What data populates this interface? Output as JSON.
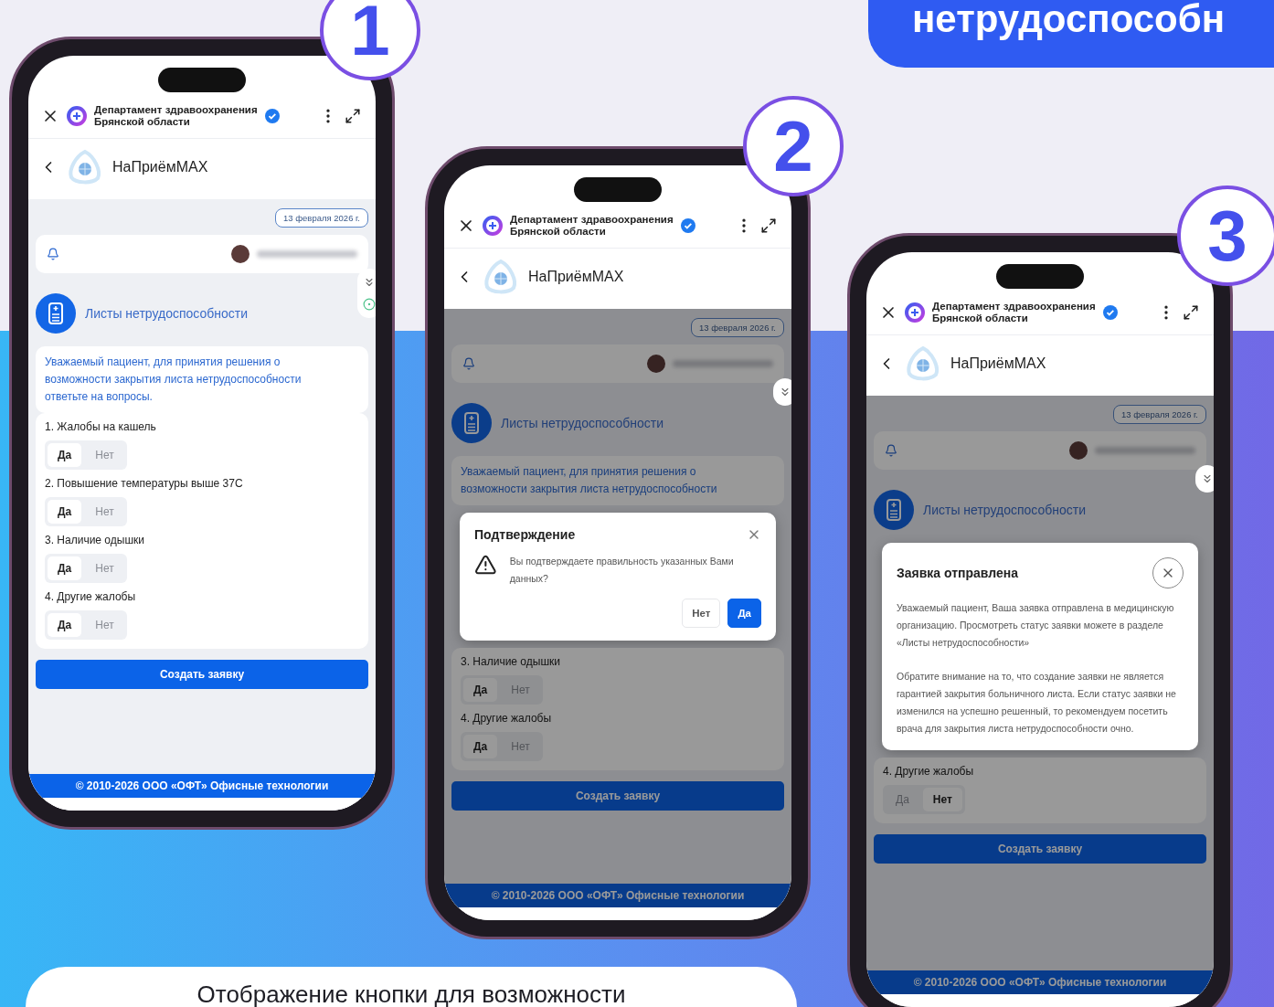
{
  "banner": {
    "text": "нетрудоспособн"
  },
  "caption": {
    "text": "Отображение кнопки для возможности"
  },
  "phones": [
    {
      "step": "1",
      "dimmed": false,
      "org_title_lines": [
        "Департамент здравоохранения",
        "Брянской области"
      ],
      "bot_name": "НаПриёмMAX",
      "date": "13 февраля 2026 г.",
      "side_tools": [
        {
          "kind": "chevron"
        },
        {
          "kind": "target"
        }
      ],
      "section_title": "Листы нетрудоспособности",
      "intro": "Уважаемый пациент, для принятия решения о возможности закрытия листа нетрудоспособности ответьте на вопросы.",
      "questions": [
        {
          "text": "1. Жалобы на кашель",
          "answers": [
            {
              "label": "Да",
              "selected": true
            },
            {
              "label": "Нет",
              "selected": false
            }
          ]
        },
        {
          "text": "2. Повышение температуры выше 37С",
          "answers": [
            {
              "label": "Да",
              "selected": true
            },
            {
              "label": "Нет",
              "selected": false
            }
          ]
        },
        {
          "text": "3. Наличие одышки",
          "answers": [
            {
              "label": "Да",
              "selected": true
            },
            {
              "label": "Нет",
              "selected": false
            }
          ]
        },
        {
          "text": "4. Другие жалобы",
          "answers": [
            {
              "label": "Да",
              "selected": true
            },
            {
              "label": "Нет",
              "selected": false
            }
          ]
        }
      ],
      "create_button": "Создать заявку",
      "footer": "© 2010-2026 ООО «ОФТ» Офисные технологии"
    },
    {
      "step": "2",
      "dimmed": true,
      "org_title_lines": [
        "Департамент здравоохранения",
        "Брянской области"
      ],
      "bot_name": "НаПриёмMAX",
      "date": "13 февраля 2026 г.",
      "side_tools": [
        {
          "kind": "chevron"
        }
      ],
      "section_title": "Листы нетрудоспособности",
      "intro": "Уважаемый пациент, для принятия решения о возможности закрытия листа нетрудоспособности",
      "modal": {
        "kind": "confirm",
        "title": "Подтверждение",
        "paragraphs": [
          "Вы подтверждаете правильность указанных Вами данных?"
        ],
        "buttons": [
          {
            "label": "Нет",
            "kind": "secondary"
          },
          {
            "label": "Да",
            "kind": "primary"
          }
        ]
      },
      "questions": [
        {
          "text": "3. Наличие одышки",
          "answers": [
            {
              "label": "Да",
              "selected": true
            },
            {
              "label": "Нет",
              "selected": false
            }
          ]
        },
        {
          "text": "4. Другие жалобы",
          "answers": [
            {
              "label": "Да",
              "selected": true
            },
            {
              "label": "Нет",
              "selected": false
            }
          ]
        }
      ],
      "create_button": "Создать заявку",
      "footer": "© 2010-2026 ООО «ОФТ» Офисные технологии"
    },
    {
      "step": "3",
      "dimmed": true,
      "org_title_lines": [
        "Департамент здравоохранения",
        "Брянской области"
      ],
      "bot_name": "НаПриёмMAX",
      "date": "13 февраля 2026 г.",
      "side_tools": [
        {
          "kind": "chevron"
        }
      ],
      "section_title": "Листы нетрудоспособности",
      "modal": {
        "kind": "notice",
        "title": "Заявка отправлена",
        "paragraphs": [
          "Уважаемый пациент, Ваша заявка отправлена в медицинскую организацию. Просмотреть статус заявки можете в разделе «Листы нетрудоспособности»",
          "Обратите внимание на то, что создание заявки не является гарантией закрытия больничного листа. Если статус заявки не изменился на успешно решенный, то рекомендуем посетить врача для закрытия листа нетрудоспособности очно."
        ]
      },
      "questions": [
        {
          "text": "4. Другие жалобы",
          "answers": [
            {
              "label": "Да",
              "selected": false
            },
            {
              "label": "Нет",
              "selected": true
            }
          ]
        }
      ],
      "create_button": "Создать заявку",
      "footer": "© 2010-2026 ООО «ОФТ» Офисные технологии"
    }
  ]
}
